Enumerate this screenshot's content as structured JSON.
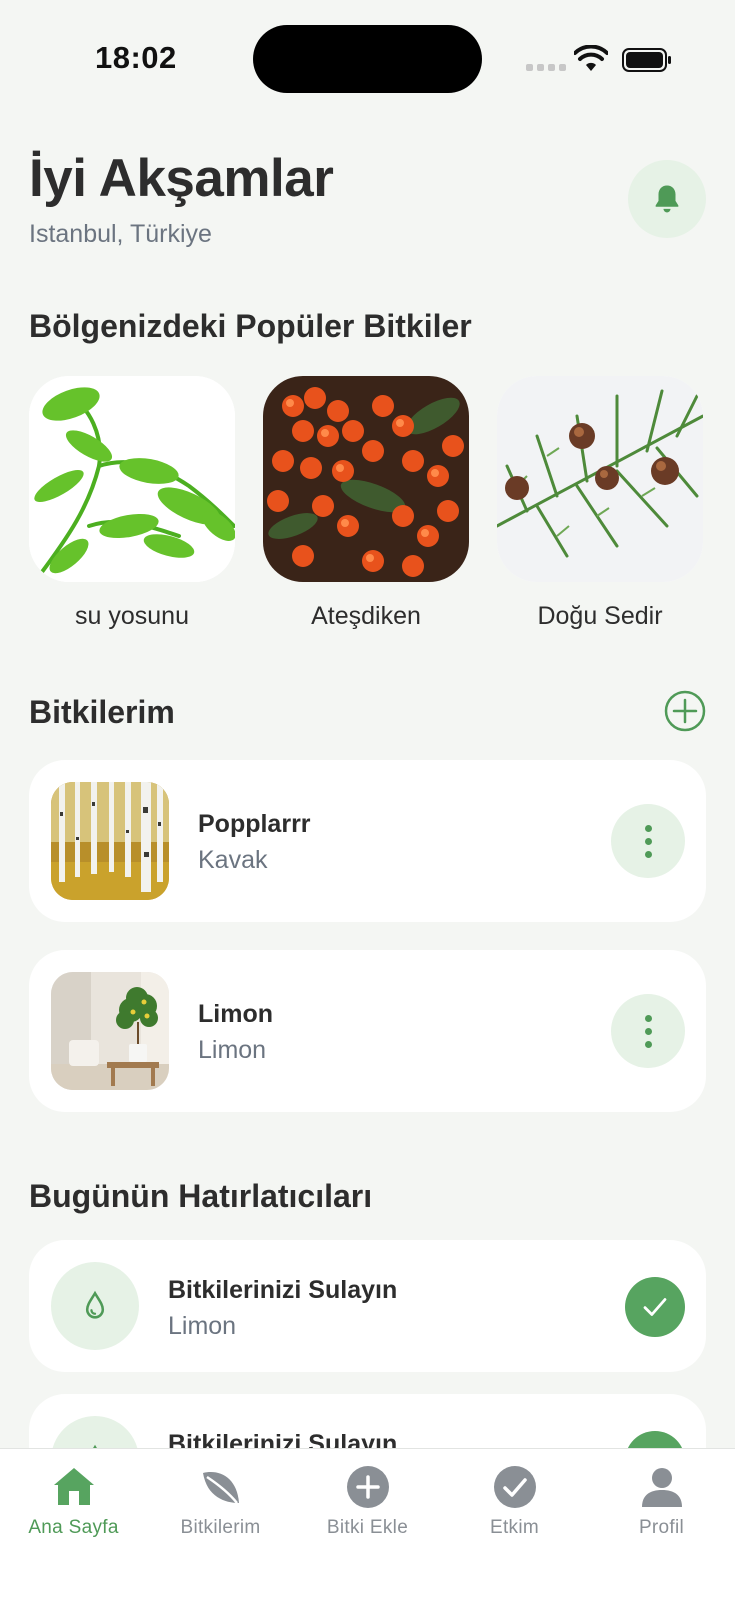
{
  "status_bar": {
    "time": "18:02"
  },
  "header": {
    "greeting": "İyi Akşamlar",
    "location": "Istanbul, Türkiye"
  },
  "popular": {
    "title": "Bölgenizdeki Popüler Bitkiler",
    "items": [
      {
        "name": "su yosunu"
      },
      {
        "name": "Ateşdiken"
      },
      {
        "name": "Doğu Sedir"
      }
    ]
  },
  "my_plants": {
    "title": "Bitkilerim",
    "items": [
      {
        "name": "Popplarrr",
        "species": "Kavak"
      },
      {
        "name": "Limon",
        "species": "Limon"
      }
    ]
  },
  "reminders": {
    "title": "Bugünün Hatırlatıcıları",
    "items": [
      {
        "title": "Bitkilerinizi Sulayın",
        "plant": "Limon"
      },
      {
        "title": "Bitkilerinizi Sulayın",
        "plant": ""
      }
    ]
  },
  "tab_bar": {
    "tabs": [
      {
        "label": "Ana Sayfa",
        "icon": "home-icon",
        "active": true
      },
      {
        "label": "Bitkilerim",
        "icon": "leaf-icon",
        "active": false
      },
      {
        "label": "Bitki Ekle",
        "icon": "plus-circle-icon",
        "active": false
      },
      {
        "label": "Etkim",
        "icon": "check-circle-icon",
        "active": false
      },
      {
        "label": "Profil",
        "icon": "person-icon",
        "active": false
      }
    ]
  },
  "colors": {
    "accent": "#57a460",
    "accent_soft": "#e6f2e6",
    "background": "#f4f6f3",
    "muted_text": "#6b7480"
  }
}
